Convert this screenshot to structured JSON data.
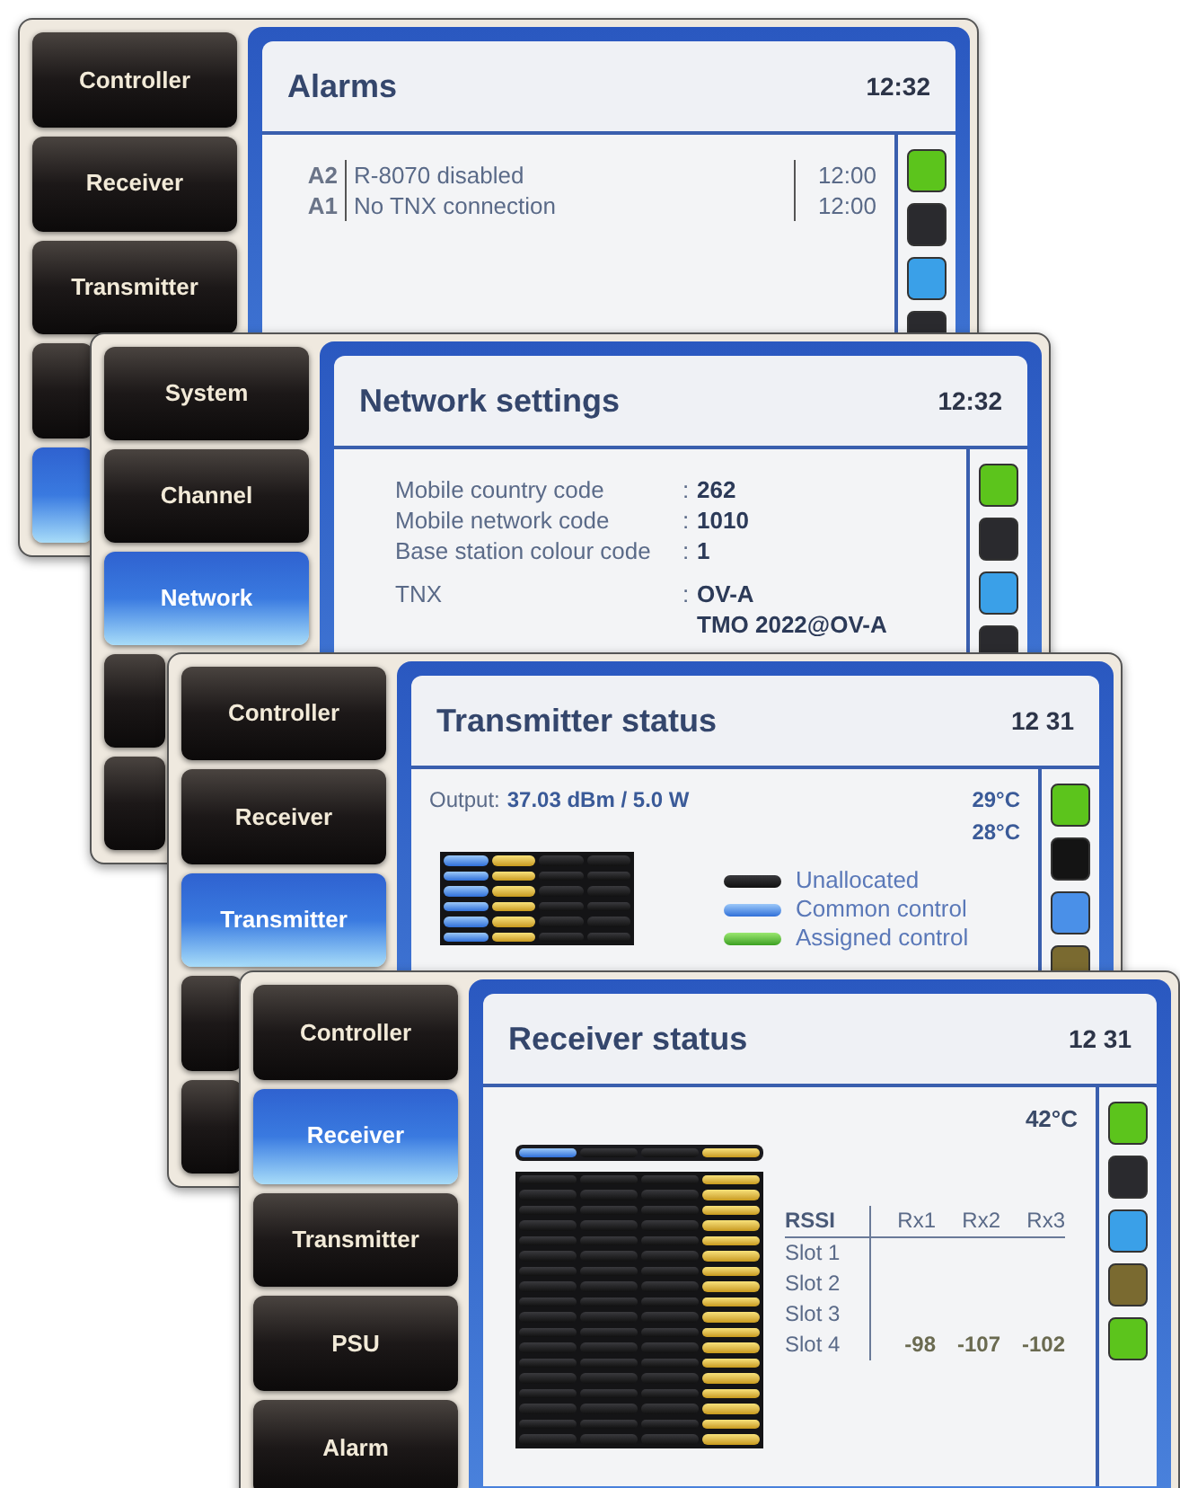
{
  "screens": [
    {
      "kind": "alarms",
      "nav": [
        {
          "label": "Controller",
          "selected": false
        },
        {
          "label": "Receiver",
          "selected": false
        },
        {
          "label": "Transmitter",
          "selected": false
        },
        {
          "selected": false
        },
        {
          "selected": true
        }
      ],
      "title": "Alarms",
      "time": "12:32",
      "alarms": [
        {
          "code": "A2",
          "text": "R-8070 disabled",
          "time": "12:00"
        },
        {
          "code": "A1",
          "text": "No TNX connection",
          "time": "12:00"
        }
      ],
      "leds": [
        {
          "color": "#5cc41c"
        },
        {
          "color": "#2a2a2e"
        },
        {
          "color": "#3aa0e8"
        },
        {
          "color": "#2a2a2e"
        }
      ]
    },
    {
      "kind": "network",
      "nav": [
        {
          "label": "System",
          "selected": false
        },
        {
          "label": "Channel",
          "selected": false
        },
        {
          "label": "Network",
          "selected": true
        },
        {
          "selected": false
        },
        {
          "selected": false
        }
      ],
      "title": "Network settings",
      "time": "12:32",
      "fields": [
        {
          "label": "Mobile country code",
          "sep": ":",
          "value": "262"
        },
        {
          "label": "Mobile network code",
          "sep": ":",
          "value": "1010"
        },
        {
          "label": "Base station colour code",
          "sep": ":",
          "value": "1"
        }
      ],
      "tnx": {
        "label": "TNX",
        "sep": ":",
        "values": [
          "OV-A",
          "TMO 2022@OV-A"
        ]
      },
      "leds": [
        {
          "color": "#5cc41c"
        },
        {
          "color": "#2a2a2e"
        },
        {
          "color": "#3aa0e8"
        },
        {
          "color": "#2a2a2e"
        }
      ]
    },
    {
      "kind": "transmitter",
      "nav": [
        {
          "label": "Controller",
          "selected": false
        },
        {
          "label": "Receiver",
          "selected": false
        },
        {
          "label": "Transmitter",
          "selected": true
        },
        {
          "selected": false
        },
        {
          "selected": false
        }
      ],
      "title": "Transmitter status",
      "time": "12 31",
      "output_label": "Output:",
      "output_value": "37.03 dBm / 5.0 W",
      "temps": [
        "29°C",
        "28°C"
      ],
      "grid_columns": [
        {
          "kind": "common"
        },
        {
          "kind": "traffic"
        },
        {
          "kind": "unallocated"
        },
        {
          "kind": "unallocated"
        }
      ],
      "legend": [
        {
          "kind": "unallocated",
          "label": "Unallocated"
        },
        {
          "kind": "common",
          "label": "Common control"
        },
        {
          "kind": "assigned",
          "label": "Assigned control"
        }
      ],
      "leds": [
        {
          "color": "#5cc41c"
        },
        {
          "color": "#141414"
        },
        {
          "color": "#4a90e8"
        },
        {
          "color": "#7a6a30"
        }
      ]
    },
    {
      "kind": "receiver",
      "nav": [
        {
          "label": "Controller",
          "selected": false
        },
        {
          "label": "Receiver",
          "selected": true
        },
        {
          "label": "Transmitter",
          "selected": false
        },
        {
          "label": "PSU",
          "selected": false
        },
        {
          "label": "Alarm",
          "selected": false
        }
      ],
      "title": "Receiver status",
      "time": "12 31",
      "temp": "42°C",
      "header_cells": [
        {
          "kind": "common"
        },
        {
          "kind": "unallocated"
        },
        {
          "kind": "unallocated"
        },
        {
          "kind": "traffic"
        }
      ],
      "grid_columns": [
        {
          "kind": "unallocated"
        },
        {
          "kind": "unallocated"
        },
        {
          "kind": "unallocated"
        },
        {
          "kind": "traffic"
        }
      ],
      "rssi": {
        "header": "RSSI",
        "columns": [
          "Rx1",
          "Rx2",
          "Rx3"
        ],
        "rows": [
          {
            "label": "Slot 1"
          },
          {
            "label": "Slot 2"
          },
          {
            "label": "Slot 3"
          },
          {
            "label": "Slot 4",
            "values": [
              "-98",
              "-107",
              "-102"
            ]
          }
        ]
      },
      "leds": [
        {
          "color": "#5cc41c"
        },
        {
          "color": "#2a2a2e"
        },
        {
          "color": "#3aa0e8"
        },
        {
          "color": "#7a6a30"
        },
        {
          "color": "#5cc41c"
        }
      ]
    }
  ]
}
